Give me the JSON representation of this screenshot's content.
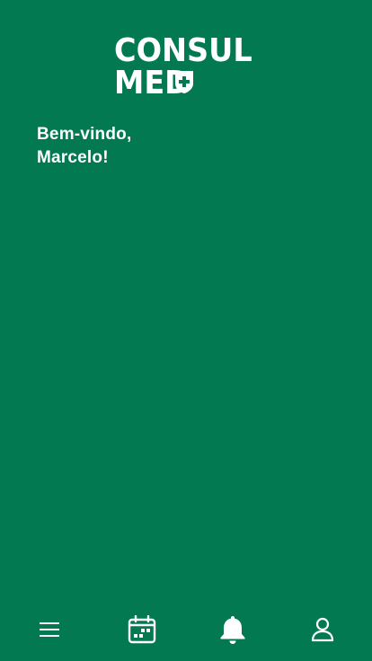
{
  "brand": {
    "line1": "CONSUL",
    "line2": "MED"
  },
  "welcome": {
    "greeting": "Bem-vindo,",
    "name": "Marcelo!"
  },
  "colors": {
    "background": "#027951",
    "foreground": "#ffffff"
  },
  "nav": {
    "items": [
      {
        "icon": "menu-icon"
      },
      {
        "icon": "calendar-icon"
      },
      {
        "icon": "bell-icon"
      },
      {
        "icon": "user-icon"
      }
    ]
  }
}
